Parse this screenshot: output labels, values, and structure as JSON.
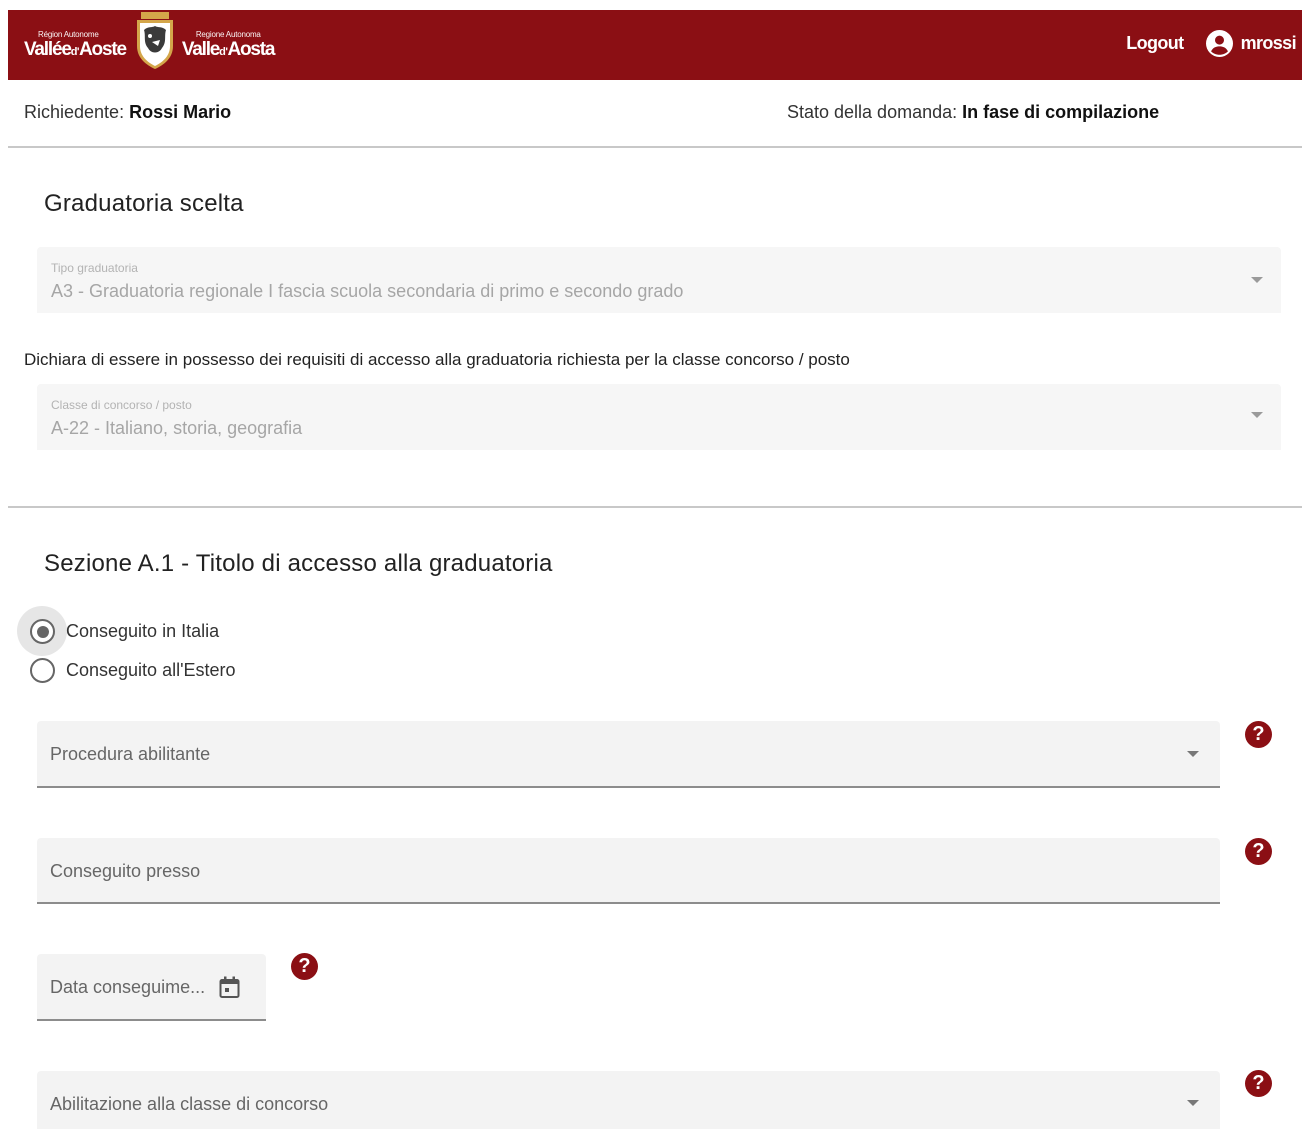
{
  "header": {
    "logo_left_small": "Région Autonome",
    "logo_left_big_a": "Vallée",
    "logo_left_big_b": "d'",
    "logo_left_big_c": "Aoste",
    "logo_right_small": "Regione Autonoma",
    "logo_right_big_a": "Valle",
    "logo_right_big_b": "d'",
    "logo_right_big_c": "Aosta",
    "logout_label": "Logout",
    "username": "mrossi",
    "brand_color": "#8b0f14"
  },
  "status": {
    "requester_label": "Richiedente: ",
    "requester_name": "Rossi Mario",
    "state_label": "Stato della domanda: ",
    "state_value": "In fase di compilazione"
  },
  "graduatoria": {
    "title": "Graduatoria scelta",
    "tipo_label": "Tipo graduatoria",
    "tipo_value": "A3 - Graduatoria regionale I fascia scuola secondaria di primo e secondo grado",
    "declare_text": "Dichiara di essere in possesso dei requisiti di accesso alla graduatoria richiesta per la classe concorso / posto",
    "classe_label": "Classe di concorso / posto",
    "classe_value": "A-22 - Italiano, storia, geografia"
  },
  "sezione": {
    "title": "Sezione A.1 - Titolo di accesso alla graduatoria",
    "radio_italia": "Conseguito in Italia",
    "radio_estero": "Conseguito all'Estero",
    "selected": "italia",
    "procedura_placeholder": "Procedura abilitante",
    "conseguito_presso_placeholder": "Conseguito presso",
    "data_placeholder": "Data conseguime...",
    "abilitazione_placeholder": "Abilitazione alla classe di concorso",
    "help_glyph": "?"
  }
}
